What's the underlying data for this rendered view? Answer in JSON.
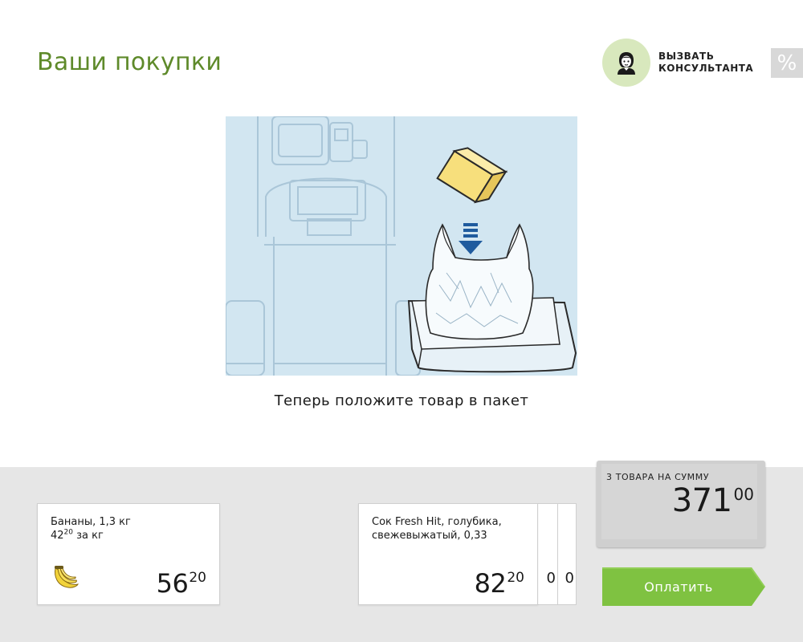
{
  "header": {
    "title": "Ваши покупки",
    "assistant": {
      "label": "ВЫЗВАТЬ КОНСУЛЬТАНТА",
      "icon": "assistant-person-icon"
    },
    "discount": {
      "symbol": "%",
      "icon": "percent-icon"
    }
  },
  "instruction": "Теперь положите товар в пакет",
  "colors": {
    "title_green": "#5e8a2a",
    "pay_green": "#7fc241",
    "illustration_bg": "#d2e6f1",
    "panel_bg": "#e6e6e6",
    "arrow_blue": "#1f5b9e",
    "box_yellow": "#f7df7c"
  },
  "items": [
    {
      "name": "Бананы, 1,3 кг",
      "unit_price_main": "42",
      "unit_price_cents": "20",
      "unit_suffix": "за кг",
      "price_main": "56",
      "price_cents": "20",
      "icon": "banana-icon"
    },
    {
      "name": "Сок Fresh Hit, голубика, свежевыжатый, 0,33",
      "price_main": "82",
      "price_cents": "20",
      "stack_edge_1": "0",
      "stack_edge_2": "0"
    }
  ],
  "total": {
    "label": "3 ТОВАРА НА СУММУ",
    "amount_main": "371",
    "amount_cents": "00"
  },
  "pay_button": {
    "label": "Оплатить"
  }
}
